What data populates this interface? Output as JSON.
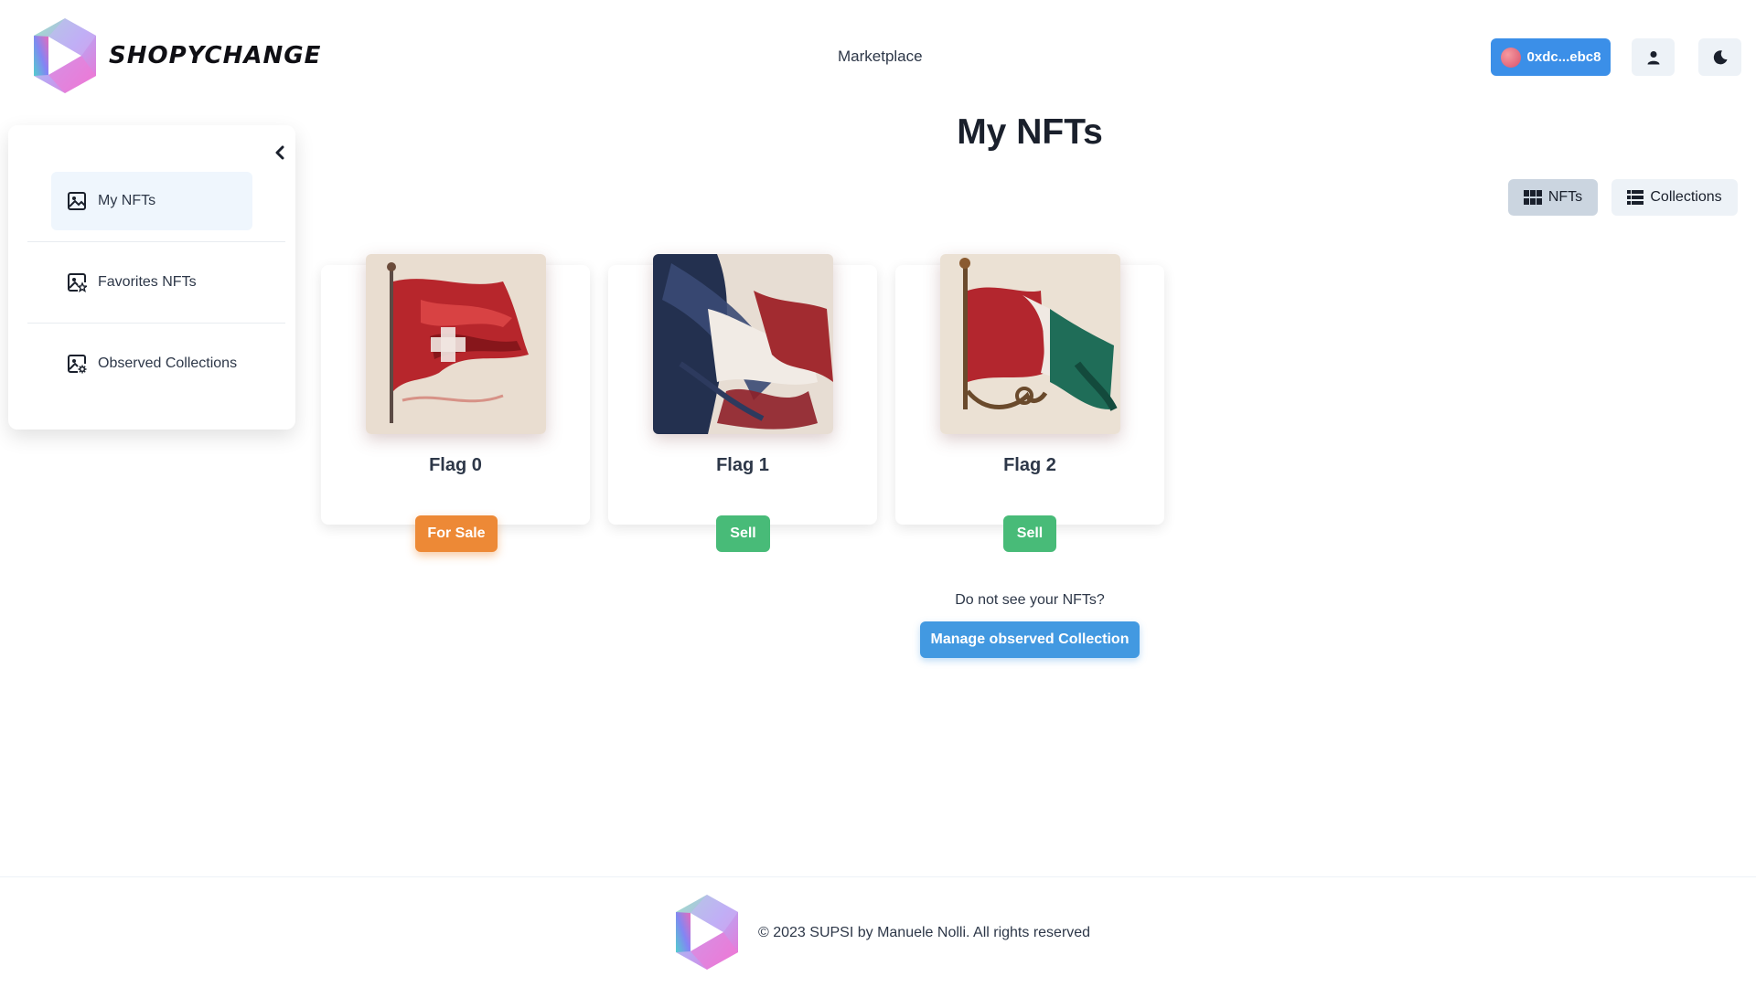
{
  "header": {
    "brand": "SHOPYCHANGE",
    "nav_marketplace": "Marketplace",
    "wallet_label": "0xdc...ebc8",
    "icons": {
      "user": "user-icon",
      "theme": "moon-icon"
    }
  },
  "sidebar": {
    "items": [
      {
        "label": "My NFTs",
        "icon": "image-icon",
        "active": true
      },
      {
        "label": "Favorites NFTs",
        "icon": "image-star-icon",
        "active": false
      },
      {
        "label": "Observed Collections",
        "icon": "image-gear-icon",
        "active": false
      }
    ]
  },
  "main": {
    "title": "My NFTs",
    "view_toggle": {
      "nfts": "NFTs",
      "collections": "Collections"
    },
    "cards": [
      {
        "title": "Flag 0",
        "button": "For Sale",
        "button_color": "#ed8936"
      },
      {
        "title": "Flag 1",
        "button": "Sell",
        "button_color": "#48bb78"
      },
      {
        "title": "Flag 2",
        "button": "Sell",
        "button_color": "#48bb78"
      }
    ],
    "hint": "Do not see your NFTs?",
    "manage_button": "Manage observed Collection"
  },
  "footer": {
    "text": "© 2023 SUPSI by Manuele Nolli. All rights reserved"
  },
  "colors": {
    "primary_blue": "#3b8fe8",
    "orange": "#ed8936",
    "green": "#48bb78"
  }
}
